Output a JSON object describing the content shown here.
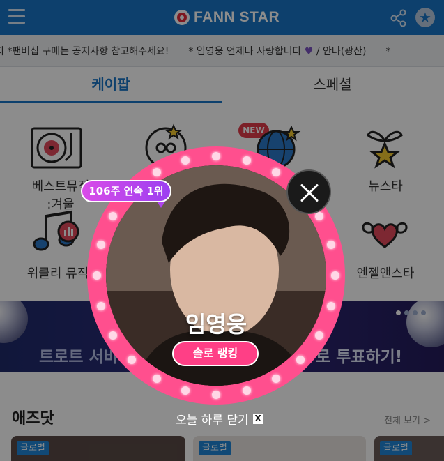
{
  "header": {
    "logo_text": "FANN STAR",
    "brand_color": "#1976c6"
  },
  "ticker": {
    "item_1": "지 *팬버십 구매는 공지사항 참고해주세요!",
    "item_2_before": "* 임영웅 언제나 사랑합니다",
    "item_2_after": "/ 안나(광산)",
    "item_3": "*"
  },
  "tabs": [
    {
      "label": "케이팝",
      "active": true
    },
    {
      "label": "스페셜",
      "active": false
    }
  ],
  "menu": {
    "best_music_line1": "베스트뮤직",
    "best_music_line2": ":겨울",
    "new_star": "뉴스타",
    "weekly_music": "위클리 뮤직",
    "angel_and_star": "엔젤앤스타",
    "new_badge": "NEW"
  },
  "banner": {
    "text_left": "트로트 서바",
    "text_right": "로 투표하기!"
  },
  "ads": {
    "title": "애즈닷",
    "more": "전체 보기 >",
    "tag": "글로벌"
  },
  "popup": {
    "badge": "106주 연속 1위",
    "name": "임영웅",
    "button": "솔로 랭킹",
    "today_close": "오늘 하루 닫기",
    "x_label": "X"
  }
}
